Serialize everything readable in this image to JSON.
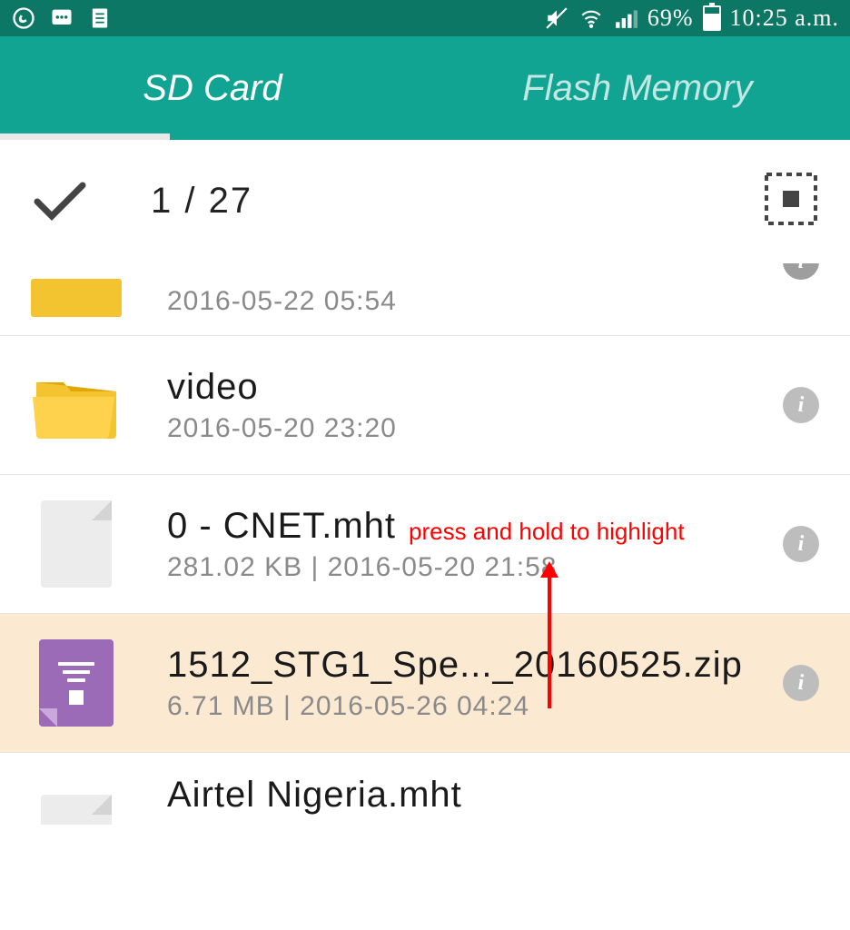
{
  "status_bar": {
    "battery_percent": "69%",
    "time": "10:25 a.m."
  },
  "tabs": {
    "sd_card": "SD Card",
    "flash_memory": "Flash Memory"
  },
  "selection": {
    "count_label": "1 / 27"
  },
  "files": [
    {
      "name": "",
      "meta": "2016-05-22 05:54",
      "type": "folder-flat",
      "partial_top": true
    },
    {
      "name": "video",
      "meta": "2016-05-20 23:20",
      "type": "folder"
    },
    {
      "name": "0 - CNET.mht",
      "meta": "281.02 KB | 2016-05-20 21:58",
      "type": "doc"
    },
    {
      "name": "1512_STG1_Spe..._20160525.zip",
      "meta": "6.71 MB | 2016-05-26 04:24",
      "type": "zip",
      "highlighted": true
    },
    {
      "name": "Airtel Nigeria.mht",
      "meta": "",
      "type": "doc",
      "partial_bottom": true
    }
  ],
  "annotation": {
    "text": "press and hold to highlight"
  }
}
